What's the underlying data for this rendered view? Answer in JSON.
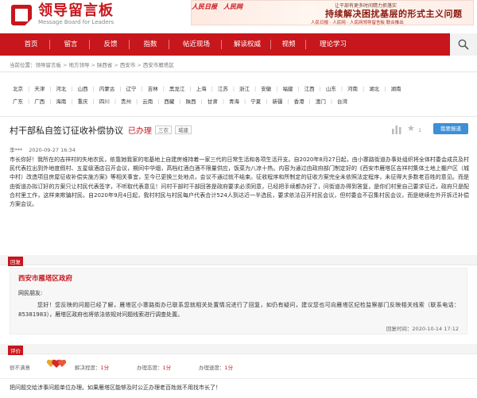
{
  "header": {
    "logo_cn": "领导留言板",
    "logo_en": "Message Board for Leaders",
    "banner": {
      "logo1": "人民日报",
      "logo2": "人民网",
      "small": "让干部有更多时间精力抓落实",
      "big": "持续解决困扰基层的形式主义问题",
      "sub": "人民日报 · 人民网 · 人民网领导留言板 联合推出"
    }
  },
  "nav": {
    "items": [
      "首页",
      "留言",
      "反馈",
      "指数",
      "帖近现场",
      "解读权威",
      "视频",
      "理论学习"
    ],
    "search_icon": "search-icon"
  },
  "breadcrumb": [
    "当前位置：",
    "领导留言板",
    "地方领导",
    "陕西省",
    "西安市",
    "西安市雁塔区"
  ],
  "provinces": {
    "row1": [
      "北京",
      "天津",
      "河北",
      "山西",
      "内蒙古",
      "辽宁",
      "吉林",
      "黑龙江",
      "上海",
      "江苏",
      "浙江",
      "安徽",
      "福建",
      "江西",
      "山东",
      "河南",
      "湖北",
      "湖南"
    ],
    "row2": [
      "广东",
      "广西",
      "海南",
      "重庆",
      "四川",
      "贵州",
      "云南",
      "西藏",
      "陕西",
      "甘肃",
      "青海",
      "宁夏",
      "新疆",
      "香港",
      "澳门",
      "台湾"
    ]
  },
  "post": {
    "title": "村干部私自签订征收补偿协议",
    "status": "已办理",
    "tags": [
      "三农",
      "城建"
    ],
    "like_count": "1",
    "report_label": "我要报道",
    "author": "李***",
    "date": "2020-09-27 16:34",
    "body": "市长你好！我所在的吉祥村的失地农民，依靠她我家的宅基地上自建房维持着一家三代的日常生活和各项生活开支。自2020年8月27日起，由小寨路街道办事处组织将全体村委会成员及村民代表拉出到外地度假村、五星级酒店召开会议，期间中华烟，高档红酒白酒不限量供应，饭菜为八凉十热。内容为通过由政府部门制定好的《西安市雁塔区吉祥村集体土地上棚户区（城中村）改造项目房屋征收补偿实施方案》等相关事宜，至今已更换三处地点，会议不通过就不结束。征收程序和所制定的征收方案完全未依照法定程序，未征得大多数老百姓的意见。而是由街道办拟订好的方案只让村民代表签字，不听取代表意见！问村干部时干部回答是政府要求必须同意，已经把手续都办好了，问街道办得到答复，是你们村里自己要求征迁，政府只是配合村里工作，这样来欺骗村民。自2020年9月4日起，我村村民与村民每户代表合计524人到达近一半选民，要求依法召开村民会议，但村委会不召集村民会议，而是继续在外开拆迁补偿方案会议。"
  },
  "reply": {
    "section_label": "回复",
    "org": "西安市雁塔区政府",
    "greeting": "网民朋友:",
    "text": "您好！您反映的问题已经了解，雁塔区小寨路街办已联系您就相关处置情况进行了回复，如仍有疑问，建议您也可向雁塔区纪检监察部门反映相关线索（联系电话：85381983），雁塔区政府也将依法依规对问题线索进行调查处置。",
    "time_label": "回复时间：",
    "time": "2020-10-14 17:12"
  },
  "evaluation": {
    "section_label": "评价",
    "label_unsatisfied": "很不满意",
    "metrics": [
      {
        "label": "解决程度：",
        "score": "1分"
      },
      {
        "label": "办理态度：",
        "score": "1分"
      },
      {
        "label": "办理速度：",
        "score": "1分"
      }
    ],
    "comment": "把问题交给涉事问题单位办理。如果雁塔区能够及时公正办理老百姓就不用找市长了！"
  },
  "colors": {
    "brand": "#c8161d",
    "report": "#3d8fd8"
  }
}
